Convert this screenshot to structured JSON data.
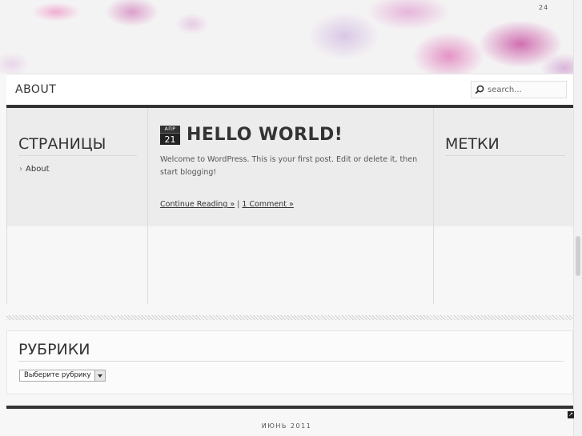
{
  "header": {
    "top_number": "24"
  },
  "nav": {
    "about_label": "ABOUT",
    "search_placeholder": "search...",
    "search_icon": "search-icon"
  },
  "sidebar_left": {
    "title": "СТРАНИЦЫ",
    "items": [
      {
        "label": "About"
      }
    ]
  },
  "post": {
    "date_month": "АПР",
    "date_day": "21",
    "title": "HELLO WORLD!",
    "body": "Welcome to WordPress. This is your first post. Edit or delete it, then start blogging!",
    "continue_label": "Continue Reading »",
    "separator": "|",
    "comments_label": "1 Comment »"
  },
  "sidebar_right": {
    "title": "МЕТКИ"
  },
  "rubriki": {
    "title": "РУБРИКИ",
    "select_value": "Выберите рубрику"
  },
  "footer": {
    "text": "ИЮНЬ 2011"
  },
  "colors": {
    "dark_rule": "#333333",
    "background": "#f7f7f7",
    "accent_pink": "#c0328c"
  }
}
